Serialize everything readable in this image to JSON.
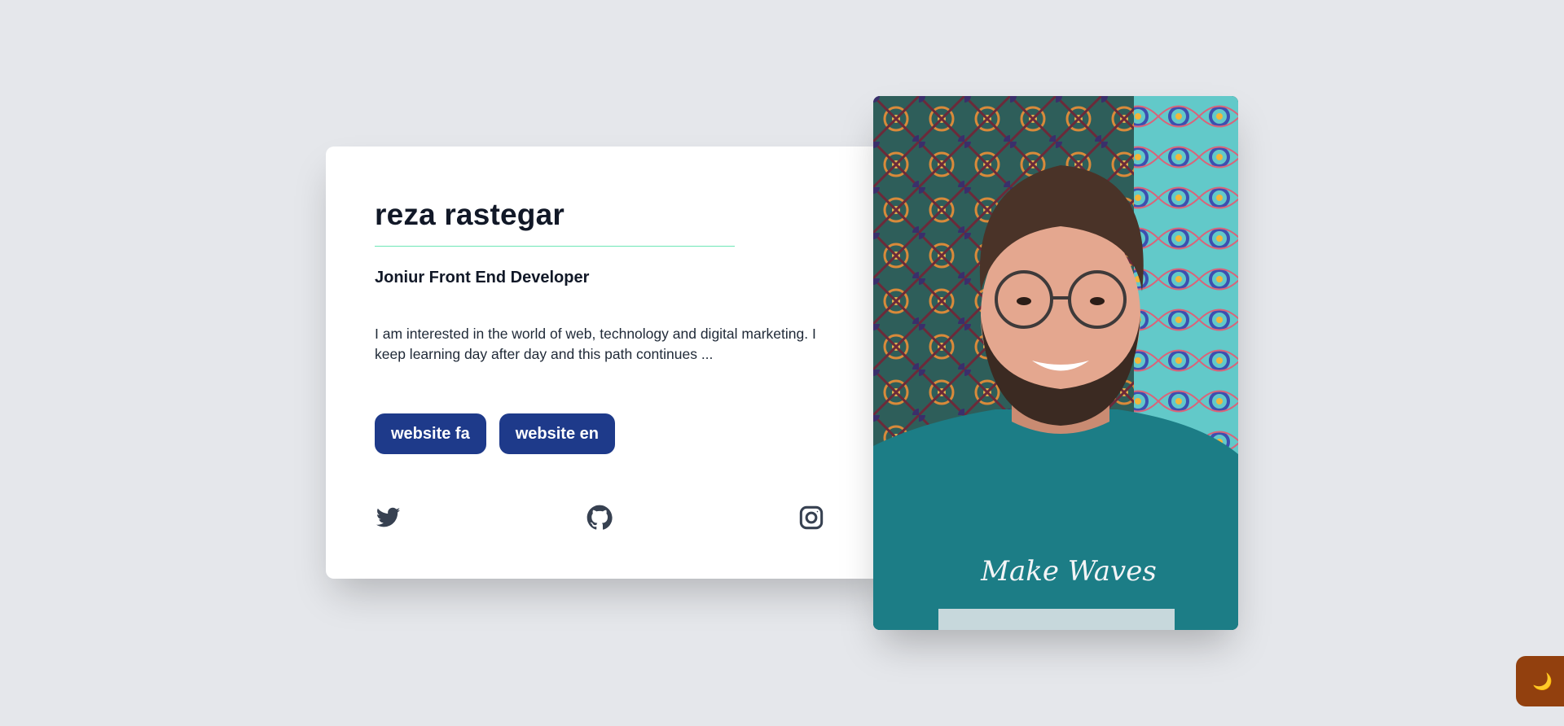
{
  "profile": {
    "name": "reza rastegar",
    "role": "Joniur Front End Developer",
    "bio": "I am interested in the world of web, technology and digital marketing. I keep learning day after day and this path continues ..."
  },
  "buttons": {
    "website_fa": "website fa",
    "website_en": "website en"
  },
  "socials": [
    {
      "icon": "twitter-icon"
    },
    {
      "icon": "github-icon"
    },
    {
      "icon": "instagram-icon"
    }
  ],
  "photo": {
    "shirt_text": "Make Waves"
  },
  "theme_toggle": {
    "icon": "🌙"
  },
  "colors": {
    "background": "#e5e7eb",
    "card": "#ffffff",
    "button": "#1e3a8a",
    "accent_rule": "#6ee7b7",
    "toggle": "#92400e"
  }
}
